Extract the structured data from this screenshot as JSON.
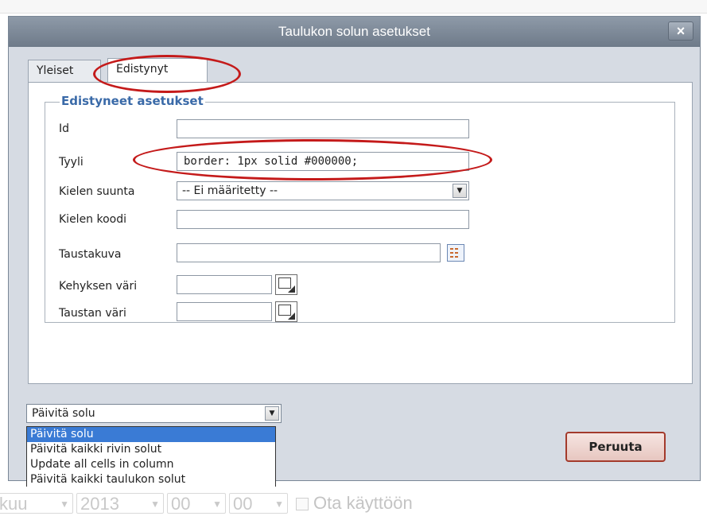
{
  "dialog": {
    "title": "Taulukon solun asetukset",
    "close_label": "×"
  },
  "tabs": [
    {
      "label": "Yleiset"
    },
    {
      "label": "Edistynyt",
      "active": true
    }
  ],
  "advanced": {
    "legend": "Edistyneet asetukset",
    "fields": {
      "id": {
        "label": "Id",
        "value": ""
      },
      "style": {
        "label": "Tyyli",
        "value": "border: 1px solid #000000;"
      },
      "dir": {
        "label": "Kielen suunta",
        "value": "-- Ei määritetty --"
      },
      "lang": {
        "label": "Kielen koodi",
        "value": ""
      },
      "bgimage": {
        "label": "Taustakuva",
        "value": ""
      },
      "bordercolor": {
        "label": "Kehyksen väri",
        "value": ""
      },
      "bgcolor": {
        "label": "Taustan väri",
        "value": ""
      }
    }
  },
  "action": {
    "selected": "Päivitä solu",
    "options": [
      "Päivitä solu",
      "Päivitä kaikki rivin solut",
      "Update all cells in column",
      "Päivitä kaikki taulukon solut"
    ]
  },
  "buttons": {
    "cancel": "Peruuta"
  },
  "background": {
    "ctl1": "kuu",
    "ctl2": "2013",
    "ctl3": "00",
    "ctl4": "00",
    "checkbox_label": "Ota käyttöön"
  },
  "colors": {
    "annotation": "#c41a1a",
    "selection": "#3a7bd5",
    "legend": "#3a6aa8"
  }
}
